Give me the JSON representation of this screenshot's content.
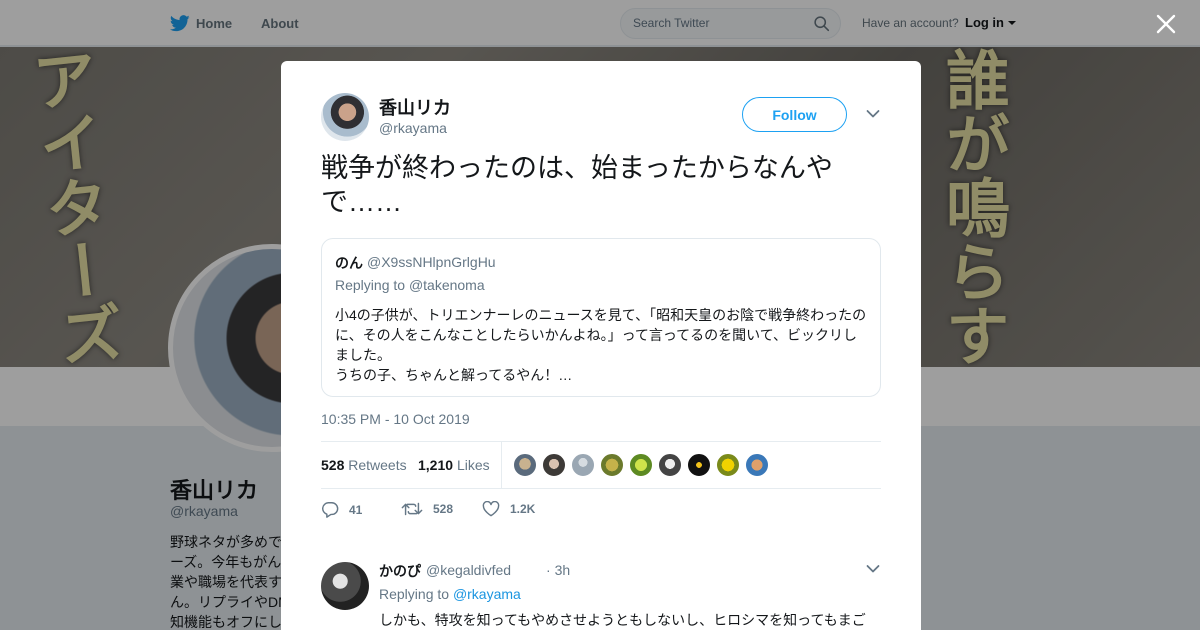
{
  "nav": {
    "home_label": "Home",
    "about_label": "About",
    "search_placeholder": "Search Twitter",
    "have_account": "Have an account?",
    "login_label": "Log in",
    "brand_color": "#1da1f2"
  },
  "banner": {
    "left_text": "アイターズ",
    "right_text": "誰が鳴らす"
  },
  "profile": {
    "name": "香山リカ",
    "handle": "@rkayama",
    "bio": "野球ネタが多めで\nーズ。今年もがん\n業や職場を代表す\nん。リプライやDM\n知機能もオフにし"
  },
  "overlay": {
    "close_icon": "close-icon"
  },
  "tweet": {
    "name": "香山リカ",
    "handle": "@rkayama",
    "follow_label": "Follow",
    "text": "戦争が終わったのは、始まったからなんやで……",
    "quote": {
      "name": "のん",
      "handle": "@X9ssNHlpnGrlgHu",
      "replying_prefix": "Replying to",
      "replying_handle": "@takenoma",
      "text": "小4の子供が、トリエンナーレのニュースを見て、「昭和天皇のお陰で戦争終わったのに、その人をこんなことしたらいかんよね。」って言ってるのを聞いて、ビックリしました。\nうちの子、ちゃんと解ってるやん！…"
    },
    "timestamp": "10:35 PM - 10 Oct 2019",
    "retweets_count": "528",
    "retweets_label": "Retweets",
    "likes_count": "1,210",
    "likes_label": "Likes",
    "actions": {
      "reply_count": "41",
      "retweet_count": "528",
      "like_count": "1.2K"
    }
  },
  "reply": {
    "name": "かのぴ",
    "handle": "@kegaldivfed",
    "separator": "·",
    "time": "3h",
    "replying_prefix": "Replying to",
    "replying_handle": "@rkayama",
    "text": "しかも、特攻を知ってもやめさせようともしないし、ヒロシマを知ってもまご"
  }
}
